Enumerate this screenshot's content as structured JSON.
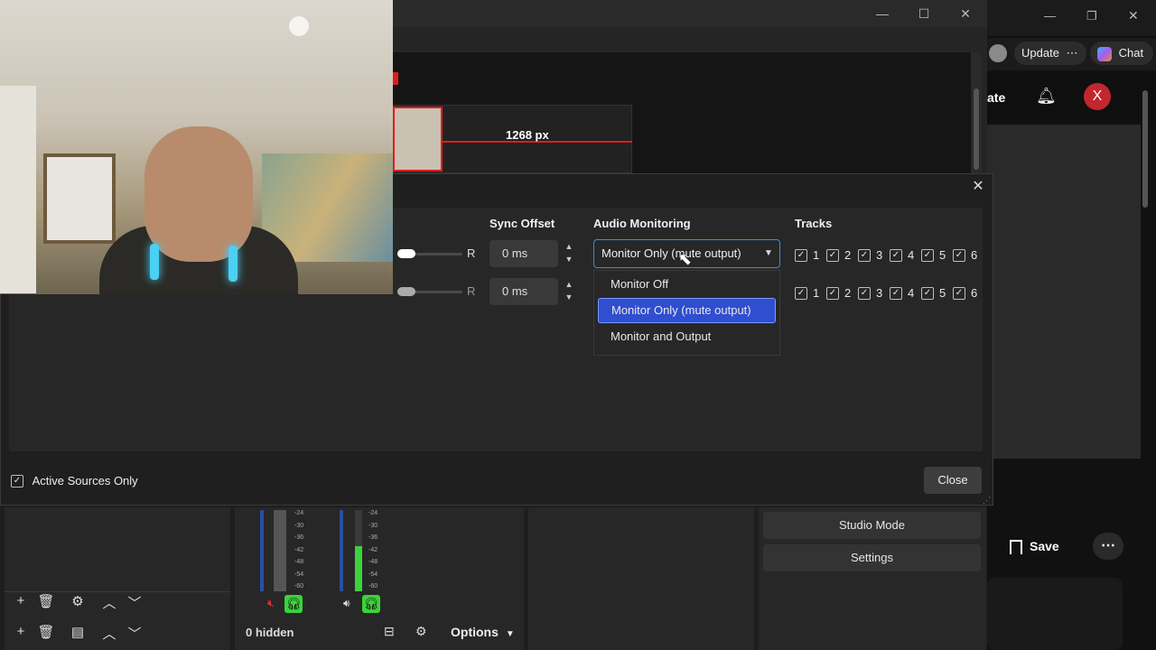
{
  "obs_window": {
    "preview_measure_label": "1268 px"
  },
  "browser": {
    "update_label": "Update",
    "more_glyph": "⋯",
    "chat_label": "Chat",
    "header_partial": "ate",
    "avatar_letter": "X",
    "save_label": "Save",
    "more_glyph2": "⋯"
  },
  "dialog": {
    "headers": {
      "sync_offset": "Sync Offset",
      "audio_monitoring": "Audio Monitoring",
      "tracks": "Tracks"
    },
    "rows": [
      {
        "balance_right_label": "R",
        "sync_offset": "0 ms",
        "monitoring": "Monitor Only (mute output)",
        "tracks": [
          "1",
          "2",
          "3",
          "4",
          "5",
          "6"
        ]
      },
      {
        "balance_right_label": "R",
        "sync_offset": "0 ms",
        "tracks": [
          "1",
          "2",
          "3",
          "4",
          "5",
          "6"
        ]
      }
    ],
    "monitoring_options": [
      "Monitor Off",
      "Monitor Only (mute output)",
      "Monitor and Output"
    ],
    "monitoring_selected_index": 1,
    "active_sources_only_label": "Active Sources Only",
    "active_sources_only_checked": true,
    "close_label": "Close"
  },
  "obs_bottom": {
    "meter_ticks": [
      "-24",
      "-30",
      "-36",
      "-42",
      "-48",
      "-54",
      "-60"
    ],
    "meter_ticks_2": [
      "-24",
      "-30",
      "-36",
      "-42",
      "-48",
      "-54",
      "-60"
    ],
    "hidden_label": "0 hidden",
    "options_label": "Options",
    "studio_mode_label": "Studio Mode",
    "settings_label": "Settings"
  },
  "colors": {
    "accent": "#2f4ed0",
    "focus_border": "#3a8ee6",
    "record_red": "#e21b1b",
    "meter_green": "#3bd23b",
    "avatar_red": "#c4262e"
  }
}
